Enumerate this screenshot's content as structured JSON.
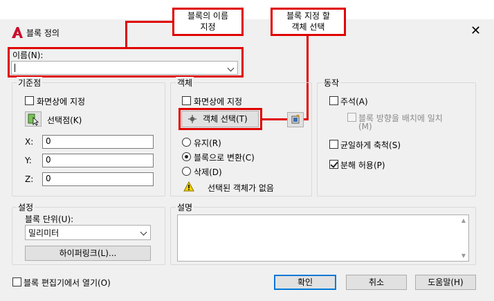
{
  "title": "블록 정의",
  "callouts": {
    "name": [
      "블록의 이름",
      "지정"
    ],
    "select": [
      "블록 지정 할",
      "객체 선택"
    ]
  },
  "name_field": {
    "label": "이름(N):",
    "value": ""
  },
  "base_point": {
    "group": "기준점",
    "on_screen": "화면상에 지정",
    "pick_point": "선택점(K)",
    "x_label": "X:",
    "x_value": "0",
    "y_label": "Y:",
    "y_value": "0",
    "z_label": "Z:",
    "z_value": "0"
  },
  "objects": {
    "group": "객체",
    "on_screen": "화면상에 지정",
    "select_objects": "객체 선택(T)",
    "retain": "유지(R)",
    "convert": "블록으로 변환(C)",
    "delete": "삭제(D)",
    "warning": "선택된 객체가 없음",
    "selected_option": "convert"
  },
  "behavior": {
    "group": "동작",
    "annotative": "주석(A)",
    "match_orientation": [
      "블록 방향을 배치에 일치",
      "(M)"
    ],
    "uniform_scale": "균일하게 축척(S)",
    "allow_explode": "분해 허용(P)",
    "annotative_checked": false,
    "uniform_checked": false,
    "explode_checked": true
  },
  "settings": {
    "group": "설정",
    "unit_label": "블록 단위(U):",
    "unit_value": "밀리미터",
    "hyperlink": "하이퍼링크(L)..."
  },
  "description": {
    "group": "설명",
    "value": ""
  },
  "footer": {
    "open_editor": "블록 편집기에서 열기(O)",
    "ok": "확인",
    "cancel": "취소",
    "help": "도움말(H)"
  },
  "colors": {
    "highlight": "#e00000",
    "default_button_border": "#0078d7"
  }
}
